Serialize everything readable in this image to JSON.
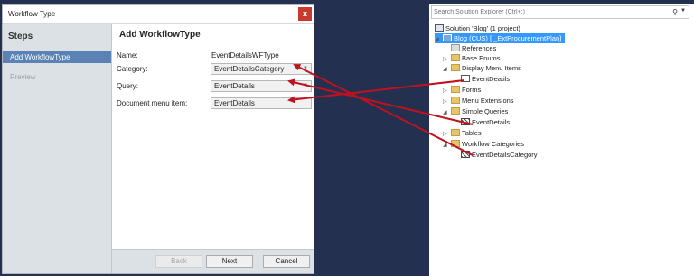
{
  "dialog": {
    "title": "Workflow Type",
    "close_glyph": "x",
    "steps_heading": "Steps",
    "steps": [
      {
        "label": "Add WorkflowType",
        "active": true
      },
      {
        "label": "Preview",
        "active": false
      }
    ],
    "page_heading": "Add WorkflowType",
    "form": {
      "name_label": "Name:",
      "name_value": "EventDetailsWFType",
      "category_label": "Category:",
      "category_value": "EventDetailsCategory",
      "query_label": "Query:",
      "query_value": "EventDetails",
      "menu_item_label": "Document menu item:",
      "menu_item_value": "EventDetails"
    },
    "buttons": {
      "back": "Back",
      "next": "Next",
      "cancel": "Cancel"
    }
  },
  "solution_explorer": {
    "search_placeholder": "Search Solution Explorer (Ctrl+;)",
    "tree": [
      {
        "label": "Solution 'Blog' (1 project)",
        "icon": "solution-icon"
      },
      {
        "label": "Blog (CUS) [     _ExtProcurementPlan]",
        "icon": "project-icon",
        "selected": true
      },
      {
        "label": "References",
        "icon": "references-icon"
      },
      {
        "label": "Base Enums",
        "icon": "folder-icon"
      },
      {
        "label": "Display Menu Items",
        "icon": "folder-icon"
      },
      {
        "label": "EventDeatils",
        "icon": "menu-item-icon"
      },
      {
        "label": "Forms",
        "icon": "folder-icon"
      },
      {
        "label": "Menu Extensions",
        "icon": "folder-icon"
      },
      {
        "label": "Simple Queries",
        "icon": "folder-icon"
      },
      {
        "label": "EventDetails",
        "icon": "query-icon"
      },
      {
        "label": "Tables",
        "icon": "folder-icon"
      },
      {
        "label": "Workflow Categories",
        "icon": "folder-icon"
      },
      {
        "label": "EventDetailsCategory",
        "icon": "category-icon"
      }
    ]
  },
  "colors": {
    "arrow": "#c0111f",
    "selection": "#3399ff",
    "step_active": "#5a82b5"
  }
}
